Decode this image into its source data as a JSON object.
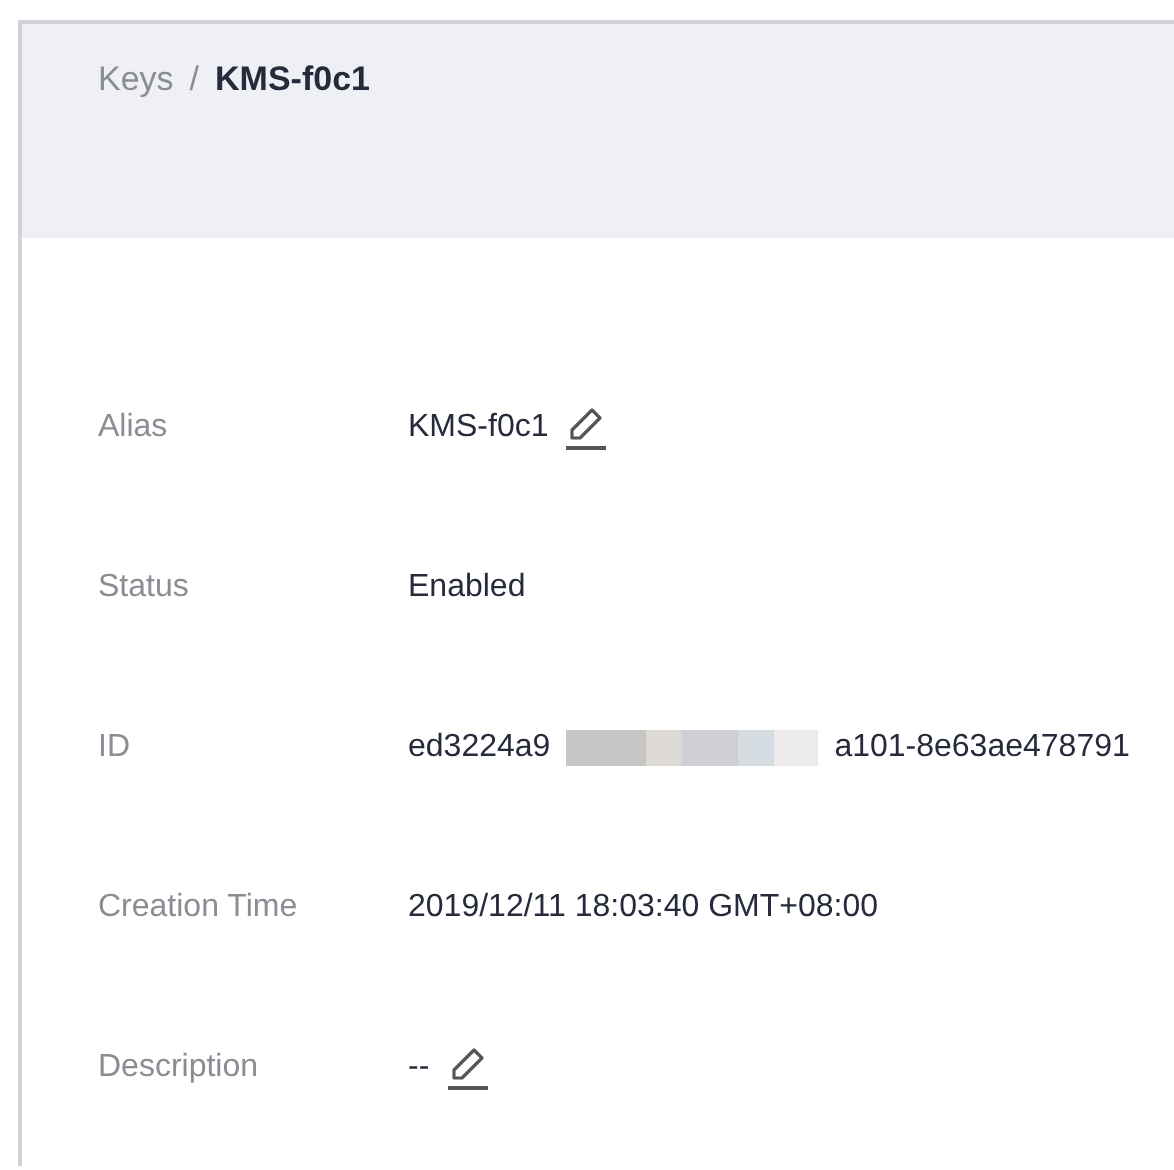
{
  "breadcrumb": {
    "parent": "Keys",
    "separator": "/",
    "current": "KMS-f0c1"
  },
  "fields": [
    {
      "label": "Alias",
      "kind": "editable",
      "value": "KMS-f0c1"
    },
    {
      "label": "Status",
      "kind": "text",
      "value": "Enabled"
    },
    {
      "label": "ID",
      "kind": "redacted",
      "value_parts": [
        "ed3224a9",
        "a101-8e63ae478791"
      ]
    },
    {
      "label": "Creation Time",
      "kind": "text",
      "value": "2019/12/11 18:03:40 GMT+08:00"
    },
    {
      "label": "Description",
      "kind": "editable",
      "value": "--"
    }
  ]
}
